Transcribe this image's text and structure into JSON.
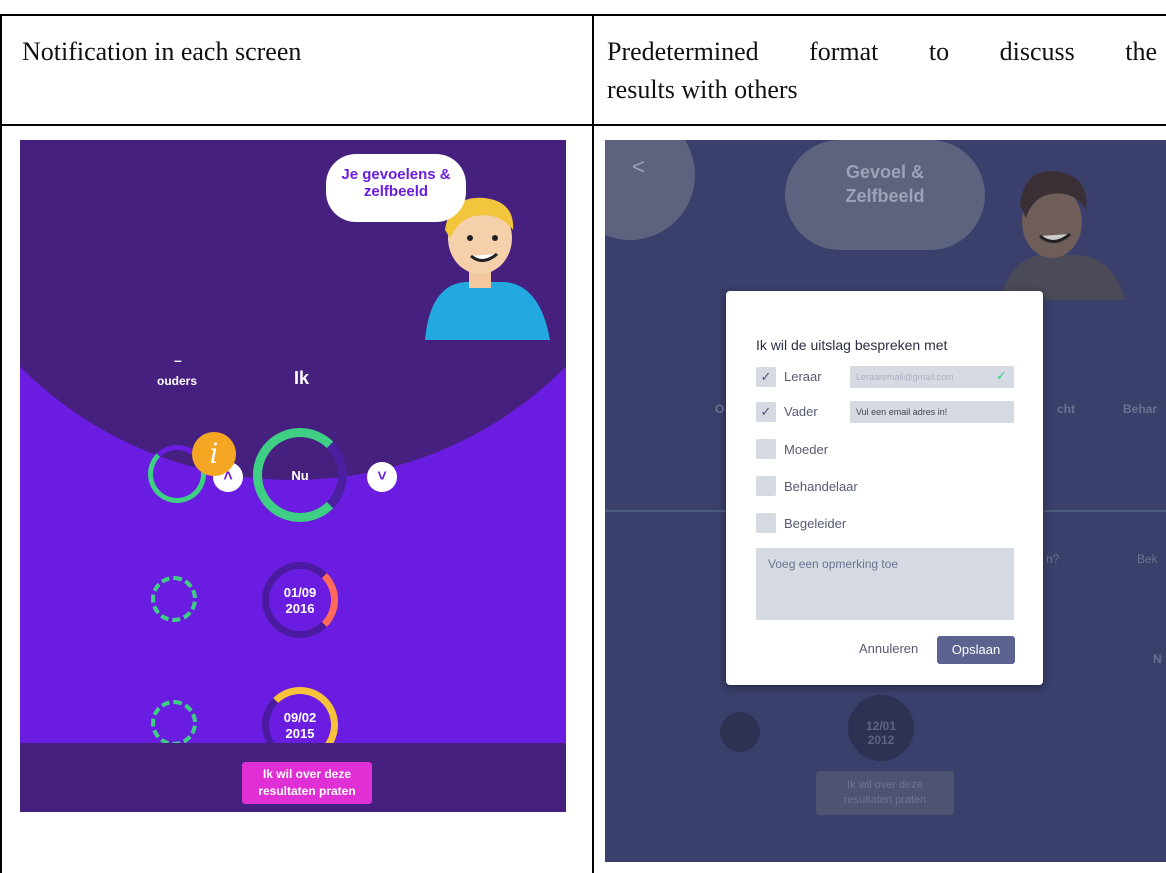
{
  "table": {
    "col1_header": "Notification in each screen",
    "col2_header_line1": "Predetermined format to discuss the",
    "col2_header_line2": "results with others"
  },
  "left_screen": {
    "bubble_text_line1": "Je gevoelens &",
    "bubble_text_line2": "zelfbeeld",
    "dash": "–",
    "col_ouders": "ouders",
    "col_ik": "Ik",
    "info_icon": "i",
    "ring_now": "Nu",
    "ring2_line1": "01/09",
    "ring2_line2": "2016",
    "ring3_line1": "09/02",
    "ring3_line2": "2015",
    "cta_line1": "Ik wil over deze",
    "cta_line2": "resultaten praten",
    "colors": {
      "purple": "#6a1de0",
      "dark_purple": "#46207f",
      "green": "#3ecf85",
      "info_orange": "#f5a623",
      "cta_pink": "#e12fd6"
    }
  },
  "right_screen": {
    "back_icon": "<",
    "bubble_line1": "Gevoel &",
    "bubble_line2": "Zelfbeeld",
    "bg_text_left": "O",
    "bg_text_mid": "cht",
    "bg_text_right": "Behar",
    "bg_text_question": "n?",
    "bg_text_bek": "Bek",
    "bg_text_n": "N",
    "bg_date_line1": "12/01",
    "bg_date_line2": "2012",
    "bg_cta_line1": "Ik wil over deze",
    "bg_cta_line2": "resultaten praten",
    "modal": {
      "title": "Ik wil de uitslag bespreken met",
      "options": [
        {
          "label": "Leraar",
          "checked": true,
          "field": "Leraaremail@gmail.com",
          "field_ok": true
        },
        {
          "label": "Vader",
          "checked": true,
          "field": "Vul een email adres in!"
        },
        {
          "label": "Moeder",
          "checked": false
        },
        {
          "label": "Behandelaar",
          "checked": false
        },
        {
          "label": "Begeleider",
          "checked": false
        }
      ],
      "comment_placeholder": "Voeg een opmerking toe",
      "cancel_label": "Annuleren",
      "save_label": "Opslaan"
    }
  }
}
